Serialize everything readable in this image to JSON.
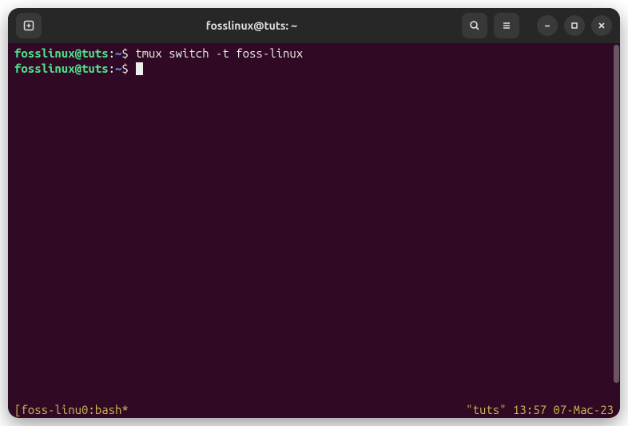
{
  "titlebar": {
    "title": "fosslinux@tuts: ~"
  },
  "terminal": {
    "lines": [
      {
        "user": "fosslinux@tuts",
        "path": "~",
        "dollar": "$",
        "command": "tmux switch -t foss-linux"
      },
      {
        "user": "fosslinux@tuts",
        "path": "~",
        "dollar": "$",
        "command": ""
      }
    ]
  },
  "statusbar": {
    "left": "[foss-linu0:bash*",
    "right": "\"tuts\" 13:57 07-Mac-23"
  }
}
